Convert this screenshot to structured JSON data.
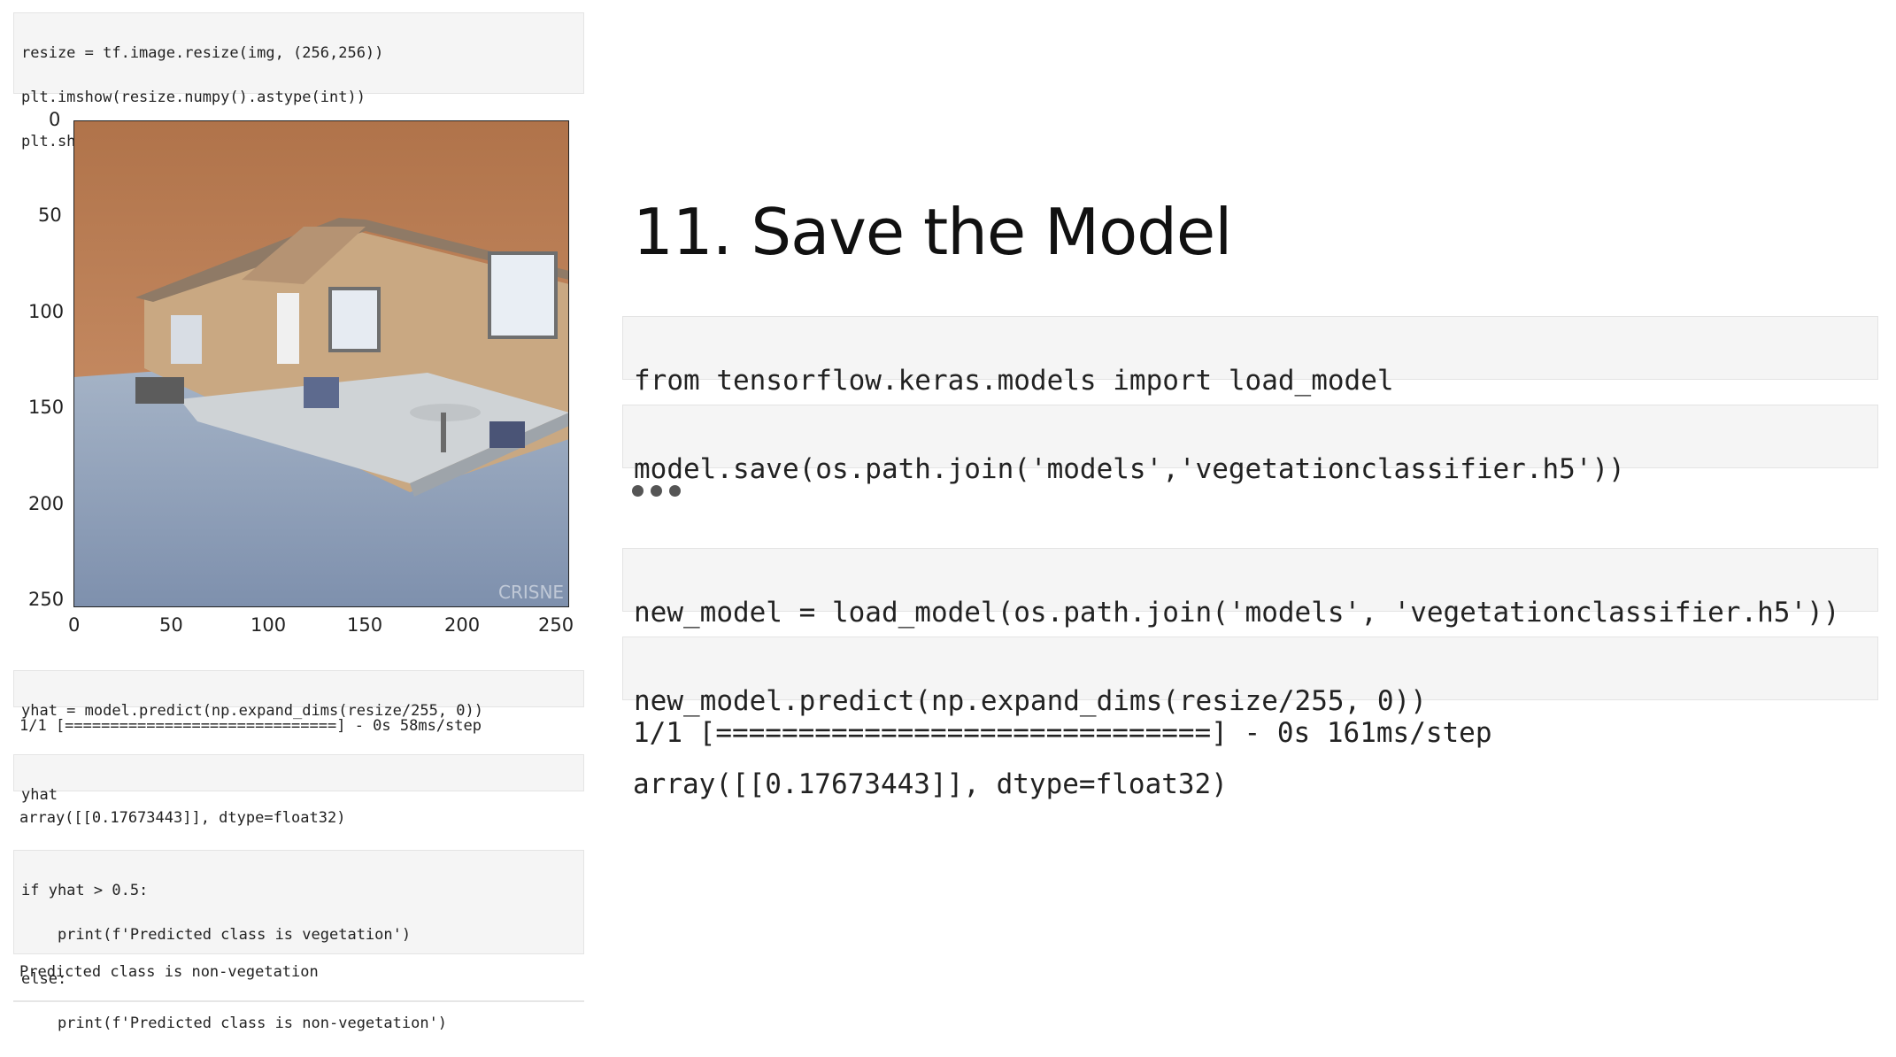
{
  "left": {
    "cell1_lines": {
      "l1": "resize = tf.image.resize(img, (256,256))",
      "l2": "plt.imshow(resize.numpy().astype(int))",
      "l3": "plt.show()"
    },
    "plot": {
      "y_ticks": [
        "0",
        "50",
        "100",
        "150",
        "200",
        "250"
      ],
      "x_ticks": [
        "0",
        "50",
        "100",
        "150",
        "200",
        "250"
      ],
      "watermark": "CRISNE"
    },
    "cell2": "yhat = model.predict(np.expand_dims(resize/255, 0))",
    "out2": "1/1 [==============================] - 0s 58ms/step",
    "cell3": "yhat",
    "out3": "array([[0.17673443]], dtype=float32)",
    "cell4": {
      "l1": "if yhat > 0.5:",
      "l2": "    print(f'Predicted class is vegetation')",
      "l3": "else:",
      "l4": "    print(f'Predicted class is non-vegetation')"
    },
    "out4": "Predicted class is non-vegetation"
  },
  "right": {
    "heading": "11. Save the Model",
    "cell_a": "from tensorflow.keras.models import load_model",
    "cell_b": "model.save(os.path.join('models','vegetationclassifier.h5'))",
    "cell_c": "new_model = load_model(os.path.join('models', 'vegetationclassifier.h5'))",
    "cell_d": "new_model.predict(np.expand_dims(resize/255, 0))",
    "out_d1": "1/1 [==============================] - 0s 161ms/step",
    "out_d2": "array([[0.17673443]], dtype=float32)"
  },
  "colors": {
    "keyword": "#1b7f1b",
    "string": "#ba2121",
    "attribute": "#1e5bb8",
    "operator": "#aa22ff",
    "cell_bg": "#f5f5f5"
  }
}
